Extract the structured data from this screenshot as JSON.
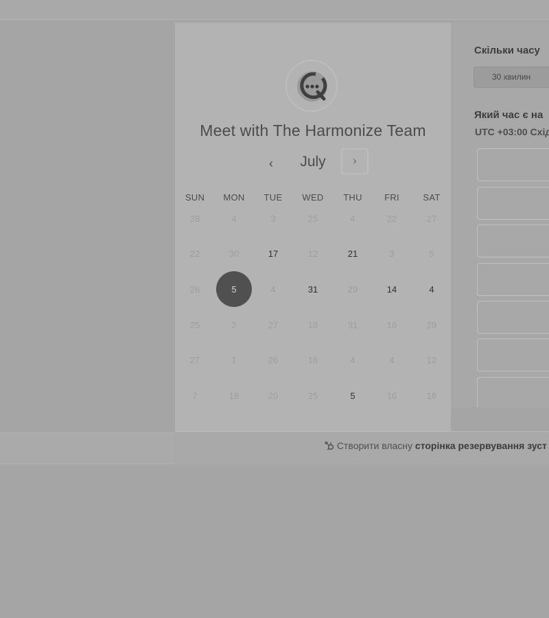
{
  "meeting": {
    "title": "Meet with The Harmonize Team"
  },
  "calendar": {
    "month": "July",
    "prev_icon": "chevron-left-icon",
    "next_icon": "chevron-right-icon",
    "weekdays": [
      "SUN",
      "MON",
      "TUE",
      "WED",
      "THU",
      "FRI",
      "SAT"
    ],
    "weeks": [
      [
        {
          "label": "28",
          "state": "disabled"
        },
        {
          "label": "4",
          "state": "disabled"
        },
        {
          "label": "3",
          "state": "disabled"
        },
        {
          "label": "25",
          "state": "disabled"
        },
        {
          "label": "4",
          "state": "disabled"
        },
        {
          "label": "22",
          "state": "disabled"
        },
        {
          "label": "27",
          "state": "disabled"
        }
      ],
      [
        {
          "label": "22",
          "state": "disabled"
        },
        {
          "label": "30",
          "state": "disabled"
        },
        {
          "label": "17",
          "state": "available"
        },
        {
          "label": "12",
          "state": "disabled"
        },
        {
          "label": "21",
          "state": "available"
        },
        {
          "label": "3",
          "state": "disabled"
        },
        {
          "label": "5",
          "state": "disabled"
        }
      ],
      [
        {
          "label": "26",
          "state": "disabled"
        },
        {
          "label": "5",
          "state": "selected"
        },
        {
          "label": "4",
          "state": "disabled"
        },
        {
          "label": "31",
          "state": "available"
        },
        {
          "label": "29",
          "state": "disabled"
        },
        {
          "label": "14",
          "state": "available"
        },
        {
          "label": "4",
          "state": "available"
        }
      ],
      [
        {
          "label": "25",
          "state": "disabled"
        },
        {
          "label": "2",
          "state": "disabled"
        },
        {
          "label": "27",
          "state": "disabled"
        },
        {
          "label": "19",
          "state": "disabled"
        },
        {
          "label": "31",
          "state": "disabled"
        },
        {
          "label": "16",
          "state": "disabled"
        },
        {
          "label": "29",
          "state": "disabled"
        }
      ],
      [
        {
          "label": "27",
          "state": "disabled"
        },
        {
          "label": "1",
          "state": "disabled"
        },
        {
          "label": "26",
          "state": "disabled"
        },
        {
          "label": "16",
          "state": "disabled"
        },
        {
          "label": "4",
          "state": "disabled"
        },
        {
          "label": "4",
          "state": "disabled"
        },
        {
          "label": "12",
          "state": "disabled"
        }
      ],
      [
        {
          "label": "7",
          "state": "disabled"
        },
        {
          "label": "18",
          "state": "disabled"
        },
        {
          "label": "20",
          "state": "disabled"
        },
        {
          "label": "25",
          "state": "disabled"
        },
        {
          "label": "5",
          "state": "available"
        },
        {
          "label": "16",
          "state": "disabled"
        },
        {
          "label": "18",
          "state": "disabled"
        }
      ]
    ]
  },
  "booking": {
    "duration_heading": "Скільки часу",
    "duration_option": "30 хвилин",
    "time_heading": "Який час є на",
    "timezone_prefix": "UTC +03:00",
    "timezone_suffix": "Схід"
  },
  "footer": {
    "prefix": "Створити власну",
    "link": "сторінка резервування зуст",
    "icon": "hubspot-sprocket-icon"
  },
  "colors": {
    "overlay_background": "#a5a5a5",
    "calendar_panel": "#b3b3b3",
    "selected_day": "#505050"
  }
}
